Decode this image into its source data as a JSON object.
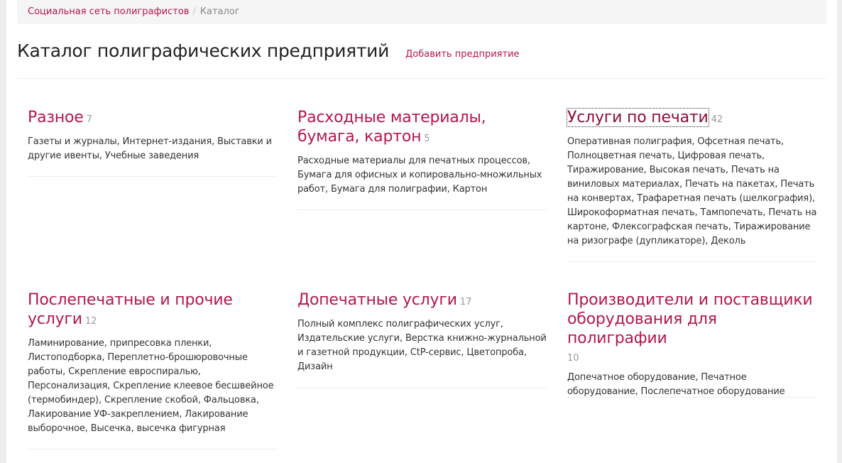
{
  "breadcrumb": {
    "home": "Социальная сеть полиграфистов",
    "separator": "/",
    "current": "Каталог"
  },
  "header": {
    "title": "Каталог полиграфических предприятий",
    "add_link": "Добавить предприятие"
  },
  "colors": {
    "accent": "#b5174a",
    "text": "#333333",
    "muted": "#999999",
    "breadcrumb_bg": "#f5f5f5"
  },
  "categories": [
    {
      "title": "Разное",
      "count": "7",
      "description": "Газеты и журналы, Интернет-издания, Выставки и другие ивенты, Учебные заведения"
    },
    {
      "title": "Расходные материалы, бумага, картон",
      "count": "5",
      "description": "Расходные материалы для печатных процессов, Бумага для офисных и копировально-множильных работ, Бумага для полиграфии, Картон"
    },
    {
      "title": "Услуги по печати",
      "count": "42",
      "description": "Оперативная полиграфия, Офсетная печать, Полноцветная печать, Цифровая печать, Тиражирование, Высокая печать, Печать на виниловых материалах, Печать на пакетах, Печать на конвертах, Трафаретная печать (шелкография), Широкоформатная печать, Тампопечать, Печать на картоне, Флексографская печать, Тиражирование на ризографе (дупликаторе), Деколь"
    },
    {
      "title": "Послепечатные и прочие услуги",
      "count": "12",
      "description": "Ламинирование, припресовка пленки, Листоподборка, Переплетно-брошюровочные работы, Скрепление евроспиралью, Персонализация, Скрепление клеевое бесшвейное (термобиндер), Скрепление скобой, Фальцовка, Лакирование УФ-закреплением, Лакирование выборочное, Высечка, высечка фигурная"
    },
    {
      "title": "Допечатные услуги",
      "count": "17",
      "description": "Полный комплекс полиграфических услуг, Издательские услуги, Верстка книжно-журнальной и газетной продукции, CtP-сервис, Цветопроба, Дизайн"
    },
    {
      "title": "Производители и поставщики оборудования для полиграфии",
      "count": "10",
      "description": "Допечатное оборудование, Печатное оборудование, Послепечатное оборудование"
    }
  ]
}
